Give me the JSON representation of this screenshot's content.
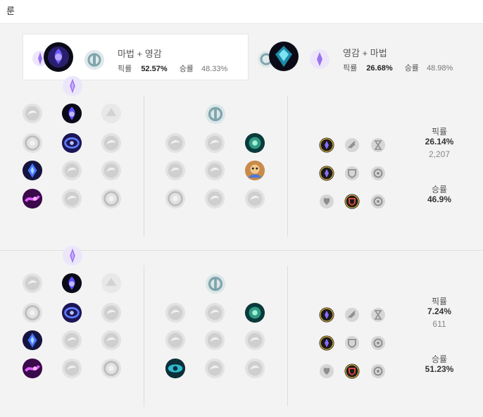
{
  "header": {
    "title": "룬"
  },
  "tabs": [
    {
      "name": "마법 + 영감",
      "pick_label": "픽률",
      "pick_value": "52.57%",
      "win_label": "승률",
      "win_value": "48.33%",
      "active": true
    },
    {
      "name": "영감 + 마법",
      "pick_label": "픽률",
      "pick_value": "26.68%",
      "win_label": "승률",
      "win_value": "48.98%",
      "active": false
    }
  ],
  "builds": [
    {
      "pick_label": "픽률",
      "pick_value": "26.14%",
      "count": "2,207",
      "win_label": "승률",
      "win_value": "46.9%"
    },
    {
      "pick_label": "픽률",
      "pick_value": "7.24%",
      "count": "611",
      "win_label": "승률",
      "win_value": "51.23%"
    }
  ],
  "colors": {
    "sorcery": "#8a5cf5",
    "inspiration": "#3fb3c7",
    "panel_bg": "#f3f3f3"
  }
}
